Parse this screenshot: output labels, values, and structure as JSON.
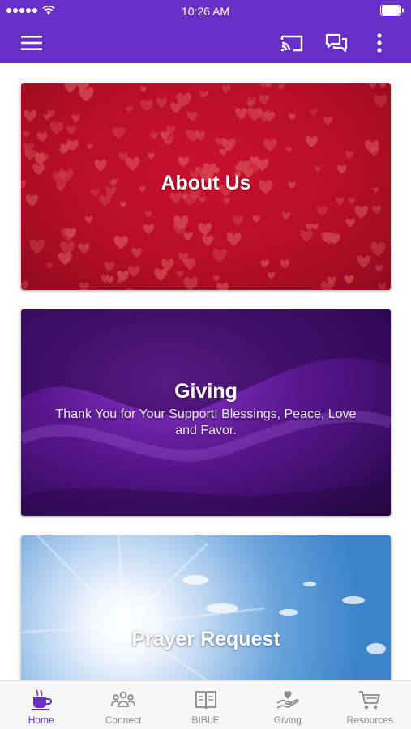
{
  "status_bar": {
    "time": "10:26 AM"
  },
  "cards": [
    {
      "title": "About Us",
      "subtitle": ""
    },
    {
      "title": "Giving",
      "subtitle": "Thank You for Your Support!  Blessings, Peace, Love and Favor."
    },
    {
      "title": "Prayer Request",
      "subtitle": ""
    }
  ],
  "tabs": [
    {
      "label": "Home",
      "icon": "coffee-cup-icon",
      "active": true
    },
    {
      "label": "Connect",
      "icon": "group-icon",
      "active": false
    },
    {
      "label": "BIBLE",
      "icon": "book-icon",
      "active": false
    },
    {
      "label": "Giving",
      "icon": "hand-heart-icon",
      "active": false
    },
    {
      "label": "Resources",
      "icon": "cart-icon",
      "active": false
    }
  ],
  "colors": {
    "brand": "#6a2ec8",
    "tab_inactive": "#8a8a8a"
  }
}
